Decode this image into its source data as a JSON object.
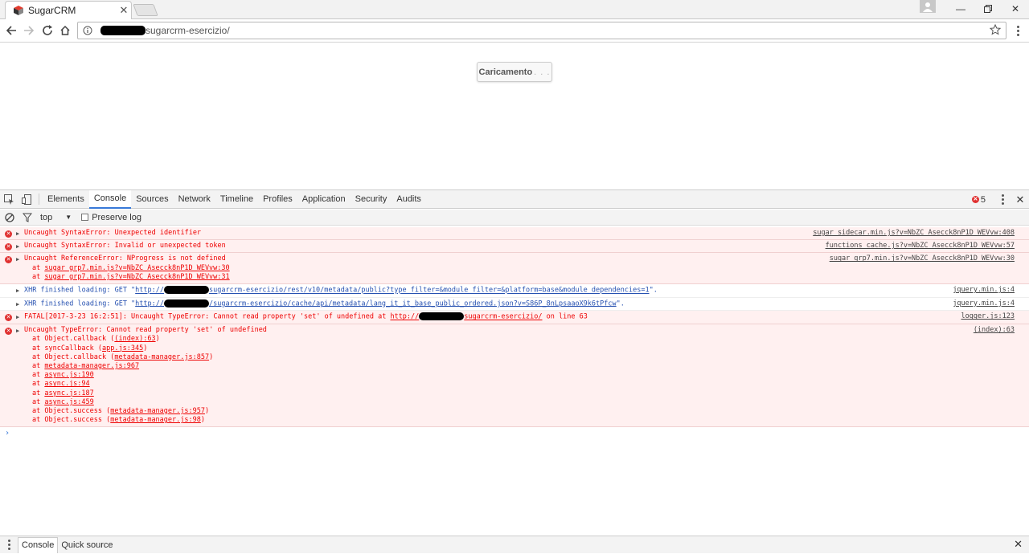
{
  "browser": {
    "tab_title": "SugarCRM",
    "url_text": "sugarcrm-esercizio/"
  },
  "page": {
    "loading_label": "Caricamento",
    "loading_ellipsis": ". . ."
  },
  "devtools": {
    "tabs": [
      "Elements",
      "Console",
      "Sources",
      "Network",
      "Timeline",
      "Profiles",
      "Application",
      "Security",
      "Audits"
    ],
    "active_tab": "Console",
    "error_count": "5",
    "context": "top",
    "preserve_log_label": "Preserve log",
    "messages": [
      {
        "type": "error",
        "text": "Uncaught SyntaxError: Unexpected identifier",
        "source": "sugar_sidecar.min.js?v=NbZC_Asecck8nP1D_WEVvw:408"
      },
      {
        "type": "error",
        "text": "Uncaught SyntaxError: Invalid or unexpected token",
        "source": "functions_cache.js?v=NbZC_Asecck8nP1D_WEVvw:57"
      },
      {
        "type": "error",
        "text": "Uncaught ReferenceError: NProgress is not defined",
        "source": "sugar_grp7.min.js?v=NbZC_Asecck8nP1D_WEVvw:30",
        "stack": [
          "sugar_grp7.min.js?v=NbZC_Asecck8nP1D_WEVvw:30",
          "sugar_grp7.min.js?v=NbZC_Asecck8nP1D_WEVvw:31"
        ]
      },
      {
        "type": "xhr",
        "prefix": "XHR finished loading: GET \"",
        "url_start": "http://",
        "url_end": "sugarcrm-esercizio/rest/v10/metadata/public?type_filter=&module_filter=&platform=base&module_dependencies=1",
        "suffix": "\".",
        "source": "jquery.min.js:4"
      },
      {
        "type": "xhr",
        "prefix": "XHR finished loading: GET \"",
        "url_start": "http://",
        "url_end": "/sugarcrm-esercizio/cache/api/metadata/lang_it_it_base_public_ordered.json?v=S86P_8nLpsaaoX9k6tPfcw",
        "suffix": "\".",
        "source": "jquery.min.js:4"
      },
      {
        "type": "error",
        "text": "FATAL[2017-3-23 16:2:51]: Uncaught TypeError: Cannot read property 'set' of undefined at ",
        "link_start": "http://",
        "link_end": "sugarcrm-esercizio/",
        "text_after": " on line 63",
        "source": "logger.js:123"
      },
      {
        "type": "error",
        "text": "Uncaught TypeError: Cannot read property 'set' of undefined",
        "source": "(index):63",
        "frames": [
          {
            "fn": "Object.callback",
            "loc": "(index):63",
            "paren": true
          },
          {
            "fn": "syncCallback",
            "loc": "app.js:345",
            "paren": true
          },
          {
            "fn": "Object.callback",
            "loc": "metadata-manager.js:857",
            "paren": true
          },
          {
            "fn": "",
            "loc": "metadata-manager.js:967",
            "paren": false
          },
          {
            "fn": "",
            "loc": "async.js:190",
            "paren": false
          },
          {
            "fn": "",
            "loc": "async.js:94",
            "paren": false
          },
          {
            "fn": "",
            "loc": "async.js:187",
            "paren": false
          },
          {
            "fn": "",
            "loc": "async.js:459",
            "paren": false
          },
          {
            "fn": "Object.success",
            "loc": "metadata-manager.js:957",
            "paren": true
          },
          {
            "fn": "Object.success",
            "loc": "metadata-manager.js:98",
            "paren": true
          }
        ]
      }
    ],
    "drawer_tabs": [
      "Console",
      "Quick source"
    ]
  }
}
